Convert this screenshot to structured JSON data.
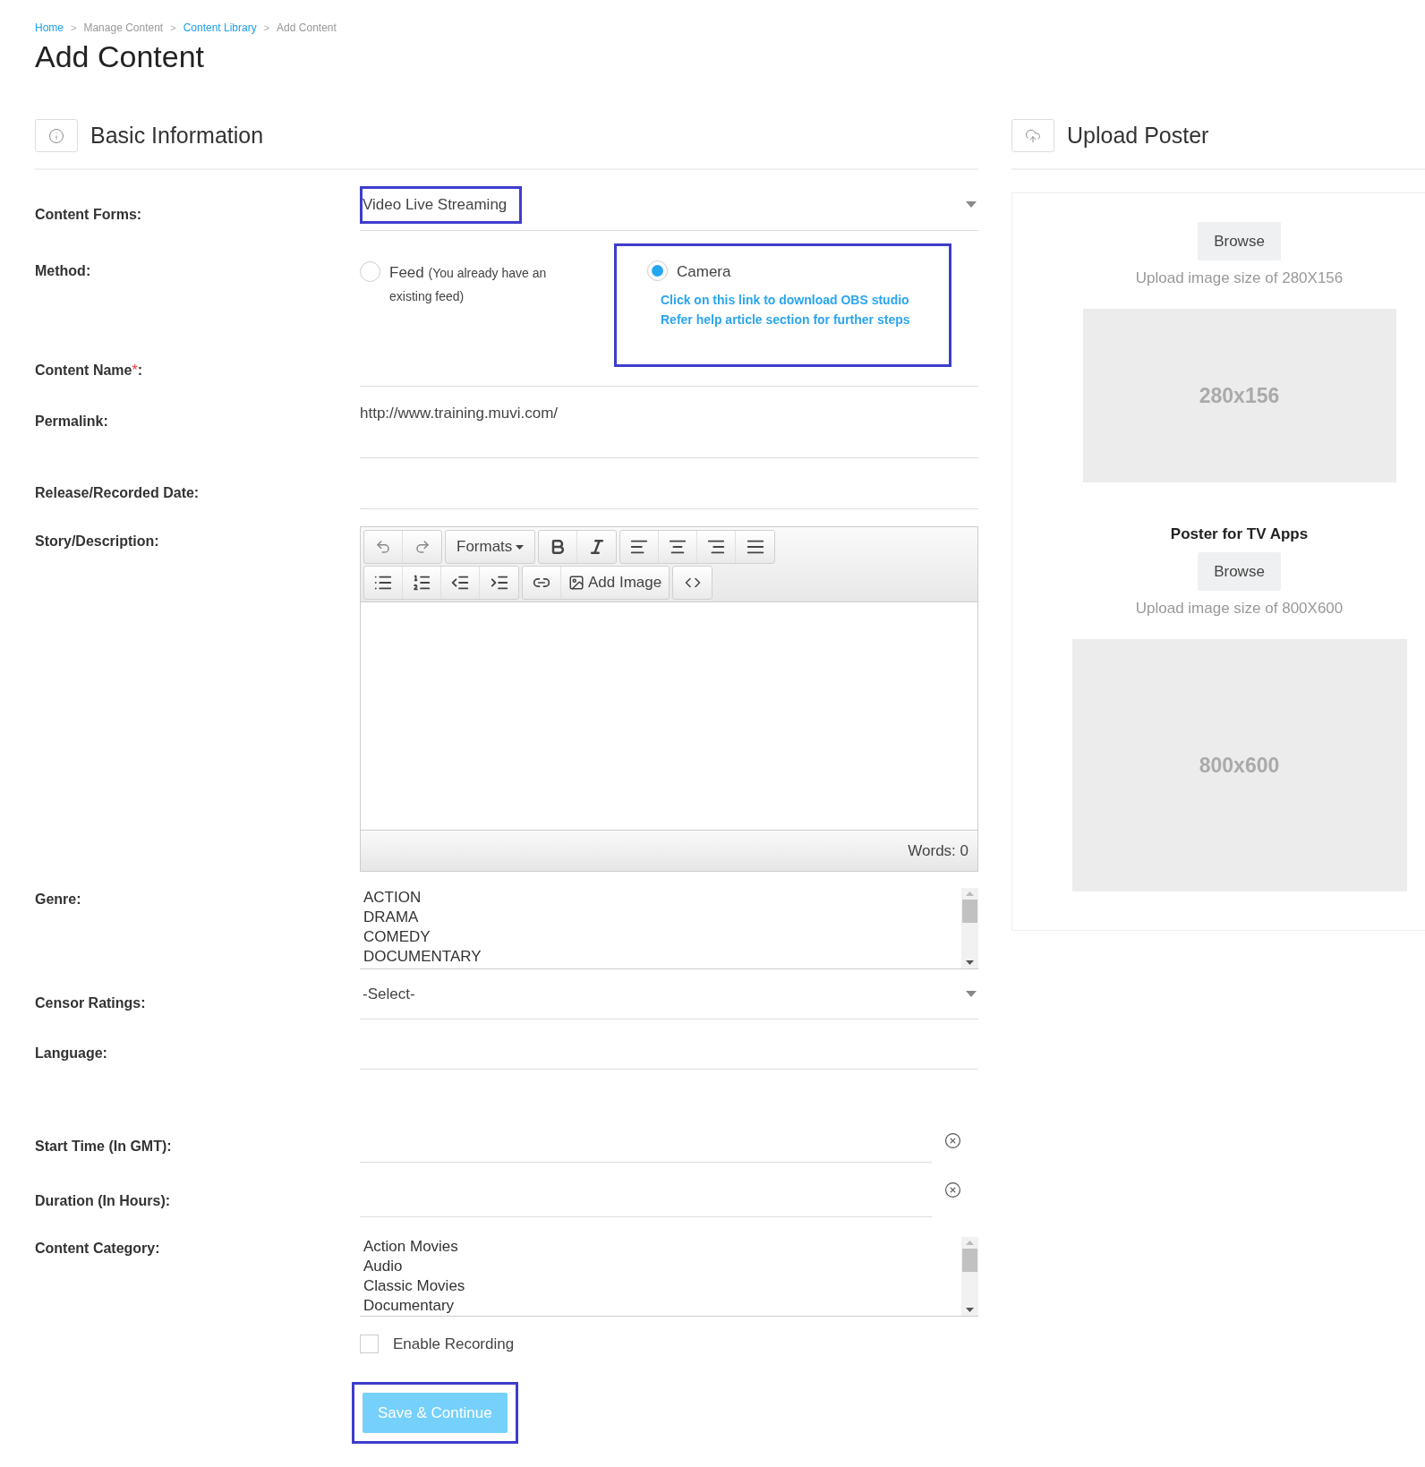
{
  "breadcrumb": [
    {
      "label": "Home",
      "link": true
    },
    {
      "label": "Manage Content",
      "link": false
    },
    {
      "label": "Content Library",
      "link": true
    },
    {
      "label": "Add Content",
      "link": false
    }
  ],
  "breadcrumb_separator": ">",
  "title": "Add Content",
  "basic_section": {
    "title": "Basic Information"
  },
  "fields": [
    {
      "kind": "select",
      "label": "Content Forms:",
      "value": "Video Live Streaming",
      "highlighted": true
    },
    {
      "kind": "method",
      "label": "Method:",
      "options": [
        {
          "label": "Feed",
          "note": "(You already have an existing feed)",
          "selected": false,
          "highlighted": false
        },
        {
          "label": "Camera",
          "selected": true,
          "highlighted": true,
          "links": [
            "Click on this link to download OBS studio",
            "Refer help article section for further steps"
          ]
        }
      ]
    },
    {
      "kind": "text",
      "label": "Content Name",
      "asterisk": "*",
      "suffix": ":"
    },
    {
      "kind": "text",
      "label": "Permalink:",
      "value": "http://www.training.muvi.com/"
    },
    {
      "kind": "text",
      "label": "Release/Recorded Date:"
    },
    {
      "kind": "editor",
      "label": "Story/Description:",
      "formats": "Formats",
      "add_image": "Add Image",
      "words": "Words: 0"
    },
    {
      "kind": "listbox",
      "label": "Genre:",
      "options": [
        "ACTION",
        "DRAMA",
        "COMEDY",
        "DOCUMENTARY"
      ]
    },
    {
      "kind": "select",
      "label": "Censor Ratings:",
      "value": "-Select-",
      "highlighted": false
    },
    {
      "kind": "text",
      "label": "Language:"
    },
    {
      "kind": "clearable",
      "label": "Start Time (In GMT):"
    },
    {
      "kind": "clearable",
      "label": "Duration (In Hours):"
    },
    {
      "kind": "listbox",
      "label": "Content Category:",
      "options": [
        "Action Movies",
        "Audio",
        "Classic Movies",
        "Documentary"
      ]
    },
    {
      "kind": "checkbox",
      "label": "Enable Recording",
      "checked": false
    },
    {
      "kind": "button",
      "label": "Save & Continue",
      "highlighted": true
    }
  ],
  "poster_section": {
    "title": "Upload Poster",
    "uploads": [
      {
        "button": "Browse",
        "hint": "Upload image size of 280X156",
        "placeholder": "280x156"
      },
      {
        "heading": "Poster for TV Apps",
        "button": "Browse",
        "hint": "Upload image size of 800X600",
        "placeholder": "800x600"
      }
    ]
  }
}
